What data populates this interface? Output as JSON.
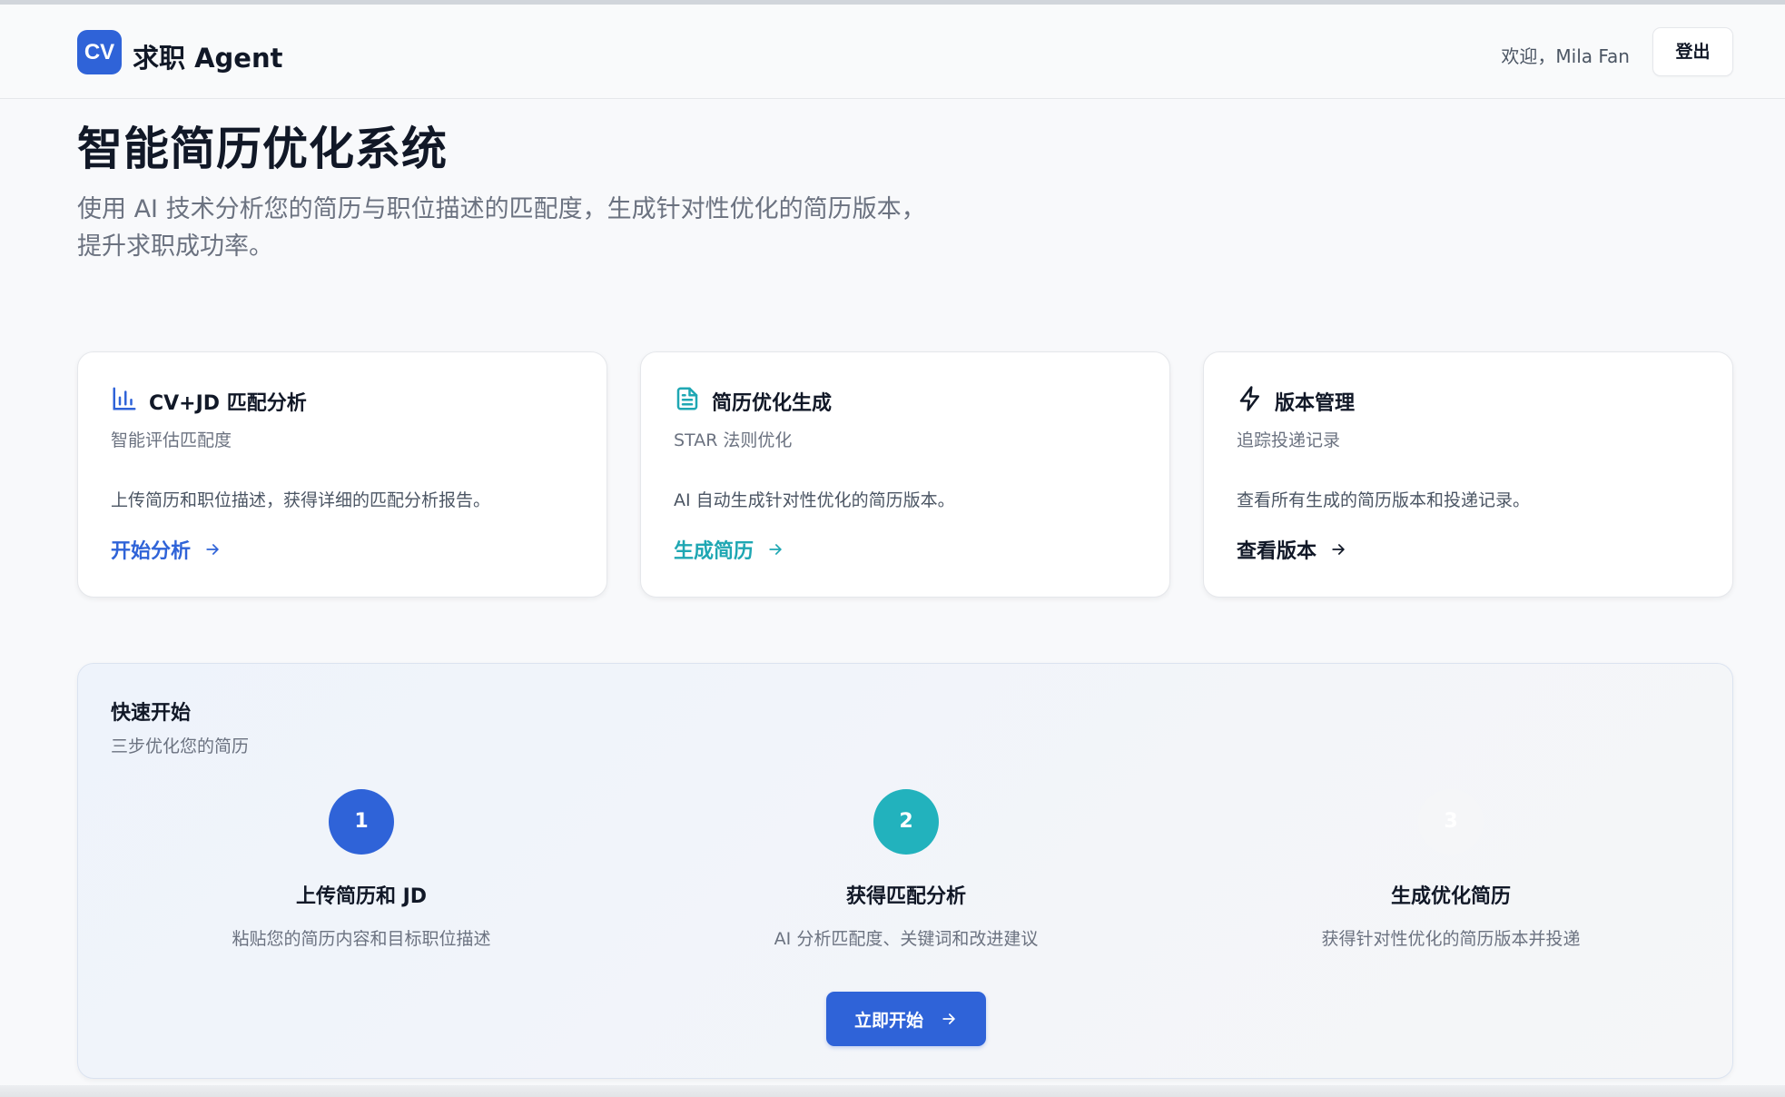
{
  "header": {
    "logo_mark": "CV",
    "app_name": "求职 Agent",
    "welcome": "欢迎，Mila Fan",
    "logout_label": "登出"
  },
  "hero": {
    "title": "智能简历优化系统",
    "description_line1": "使用 AI 技术分析您的简历与职位描述的匹配度，生成针对性优化的简历版本，",
    "description_line2": "提升求职成功率。"
  },
  "cards": [
    {
      "icon": "bar-chart-icon",
      "title": "CV+JD 匹配分析",
      "subtitle": "智能评估匹配度",
      "description": "上传简历和职位描述，获得详细的匹配分析报告。",
      "link_label": "开始分析",
      "accent": "#2f63d8"
    },
    {
      "icon": "document-icon",
      "title": "简历优化生成",
      "subtitle": "STAR 法则优化",
      "description": "AI 自动生成针对性优化的简历版本。",
      "link_label": "生成简历",
      "accent": "#1fa7b3"
    },
    {
      "icon": "lightning-icon",
      "title": "版本管理",
      "subtitle": "追踪投递记录",
      "description": "查看所有生成的简历版本和投递记录。",
      "link_label": "查看版本",
      "accent": "#111827"
    }
  ],
  "quick_start": {
    "title": "快速开始",
    "subtitle": "三步优化您的简历",
    "steps": [
      {
        "number": "1",
        "title": "上传简历和 JD",
        "description": "粘贴您的简历内容和目标职位描述",
        "color": "#2f63d8"
      },
      {
        "number": "2",
        "title": "获得匹配分析",
        "description": "AI 分析匹配度、关键词和改进建议",
        "color": "#22b2bd"
      },
      {
        "number": "3",
        "title": "生成优化简历",
        "description": "获得针对性优化的简历版本并投递",
        "color": "#f5f6f8"
      }
    ],
    "start_label": "立即开始"
  }
}
